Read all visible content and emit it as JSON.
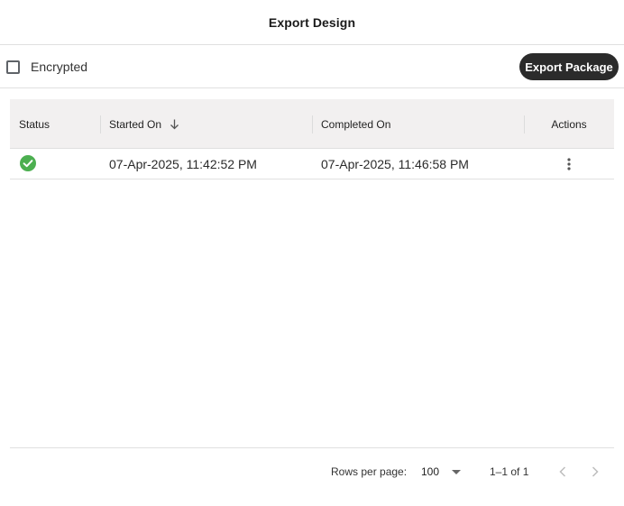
{
  "dialog": {
    "title": "Export Design"
  },
  "toolbar": {
    "encrypted_label": "Encrypted",
    "encrypted_checked": false,
    "export_button_label": "Export Package"
  },
  "table": {
    "columns": {
      "status": "Status",
      "started_on": "Started On",
      "completed_on": "Completed On",
      "actions": "Actions"
    },
    "sort": {
      "column": "started_on",
      "direction": "descending"
    },
    "rows": [
      {
        "status": "success",
        "status_icon": "check-circle-icon",
        "status_color": "#4caf50",
        "started_on": "07-Apr-2025, 11:42:52 PM",
        "completed_on": "07-Apr-2025, 11:46:58 PM",
        "actions_icon": "more-vertical-icon"
      }
    ]
  },
  "pagination": {
    "rows_per_page_label": "Rows per page:",
    "rows_per_page_value": "100",
    "range_text": "1–1 of 1",
    "prev_icon": "chevron-left-icon",
    "next_icon": "chevron-right-icon"
  },
  "colors": {
    "primary_button": "#2b2b2b",
    "header_background": "#f2f0f0",
    "success": "#4caf50"
  }
}
